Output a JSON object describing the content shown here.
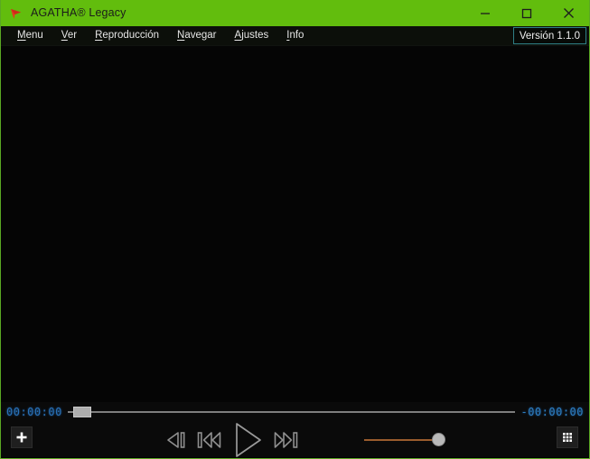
{
  "window": {
    "title": "AGATHA® Legacy",
    "app_icon": "play-triangle-icon",
    "accent_color": "#62bd0d",
    "controls": [
      {
        "name": "minimize",
        "glyph": "minimize-icon",
        "label": "Minimizar"
      },
      {
        "name": "maximize",
        "glyph": "maximize-icon",
        "label": "Maximizar"
      },
      {
        "name": "close",
        "glyph": "close-icon",
        "label": "Cerrar"
      }
    ]
  },
  "menubar": {
    "items": [
      {
        "label": "Menu",
        "accel": "M",
        "rest": "enu"
      },
      {
        "label": "Ver",
        "accel": "V",
        "rest": "er"
      },
      {
        "label": "Reproducción",
        "accel": "R",
        "rest": "eproducción"
      },
      {
        "label": "Navegar",
        "accel": "N",
        "rest": "avegar"
      },
      {
        "label": "Ajustes",
        "accel": "A",
        "rest": "justes"
      },
      {
        "label": "Info",
        "accel": "I",
        "rest": "nfo"
      }
    ],
    "version_badge": "Versión 1.1.0",
    "version_border_color": "#2f7f86"
  },
  "video": {
    "background_color": "#050505",
    "content": ""
  },
  "controls": {
    "elapsed_time": "00:00:00",
    "remaining_time": "-00:00:00",
    "timecode_color": "#2a72b8",
    "seek_position_percent": 1,
    "add_button": {
      "icon": "plus-icon",
      "label": "+"
    },
    "grid_button": {
      "icon": "grid-3x3-icon",
      "label": ""
    },
    "transport": [
      {
        "name": "step-back-button",
        "icon": "frame-step-back-icon"
      },
      {
        "name": "previous-button",
        "icon": "skip-previous-icon"
      },
      {
        "name": "play-button",
        "icon": "play-icon"
      },
      {
        "name": "next-button",
        "icon": "skip-next-icon"
      }
    ],
    "volume": {
      "level_percent": 92,
      "track_color": "#9a5c2d",
      "knob_color": "#b9b9b9"
    }
  }
}
